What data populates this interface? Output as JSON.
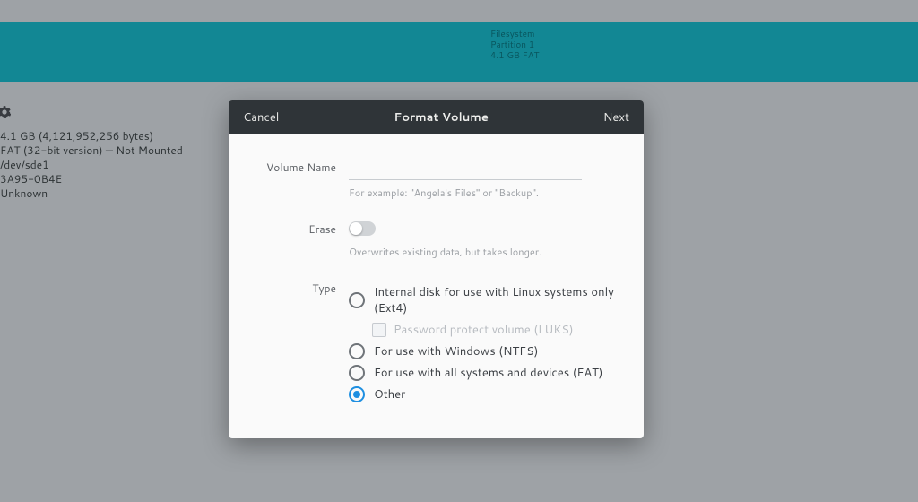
{
  "banner": {
    "line1": "Filesystem",
    "line2": "Partition 1",
    "line3": "4.1 GB FAT"
  },
  "info": {
    "size": "4.1 GB (4,121,952,256 bytes)",
    "fs": "FAT (32-bit version) — Not Mounted",
    "dev": "/dev/sde1",
    "uuid": "3A95-0B4E",
    "type": "Unknown"
  },
  "dialog": {
    "cancel": "Cancel",
    "title": "Format Volume",
    "next": "Next",
    "name_label": "Volume Name",
    "name_value": "",
    "name_hint": "For example: \"Angela's Files\" or \"Backup\".",
    "erase_label": "Erase",
    "erase_hint": "Overwrites existing data, but takes longer.",
    "type_label": "Type",
    "options": {
      "ext4": "Internal disk for use with Linux systems only (Ext4)",
      "luks": "Password protect volume (LUKS)",
      "ntfs": "For use with Windows (NTFS)",
      "fat": "For use with all systems and devices (FAT)",
      "other": "Other"
    }
  }
}
